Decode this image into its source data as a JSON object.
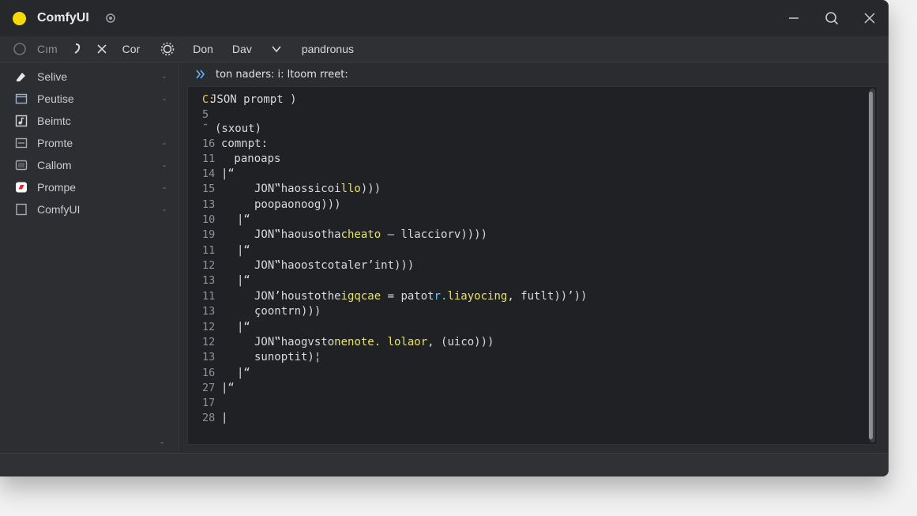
{
  "window": {
    "title": "ComfyUI"
  },
  "toolbar": {
    "items": [
      {
        "label": "Cım",
        "icon": "circle-icon"
      },
      {
        "label": "",
        "icon": "link-icon"
      },
      {
        "label": "",
        "icon": "crossed-arrows-icon"
      },
      {
        "label": "Cor"
      },
      {
        "label": "",
        "icon": "settings-icon"
      },
      {
        "label": "Don"
      },
      {
        "label": "Dav"
      },
      {
        "label": "",
        "icon": "chevron-down-icon"
      },
      {
        "label": "pandronus"
      }
    ]
  },
  "sidebar": {
    "items": [
      {
        "label": "Selive",
        "icon": "pen-icon",
        "trail": "-"
      },
      {
        "label": "Peutise",
        "icon": "window-icon",
        "trail": "-"
      },
      {
        "label": "Beimtc",
        "icon": "music-note-icon",
        "trail": ""
      },
      {
        "label": "Promte",
        "icon": "file-icon",
        "trail": "-"
      },
      {
        "label": "Callom",
        "icon": "panel-icon",
        "trail": "-"
      },
      {
        "label": "Prompe",
        "icon": "red-badge-icon",
        "trail": "-"
      },
      {
        "label": "ComfyUI",
        "icon": "document-icon",
        "trail": "-"
      }
    ],
    "bottom_mark": "-"
  },
  "breadcrumb": {
    "icon": "chevrons-right-icon",
    "text": "ton naders: i: ltoom rreet:"
  },
  "editor": {
    "lines": [
      {
        "n": "C:",
        "segs": [
          {
            "t": "JSON prompt )",
            "c": ""
          }
        ],
        "nk": true
      },
      {
        "n": "5",
        "segs": []
      },
      {
        "n": "˜",
        "segs": [
          {
            "t": "(sxout)",
            "c": ""
          }
        ]
      },
      {
        "n": "16",
        "segs": [
          {
            "t": "comnpt:",
            "c": ""
          }
        ]
      },
      {
        "n": "11",
        "segs": [
          {
            "t": " panoaps",
            "c": ""
          }
        ]
      },
      {
        "n": "14",
        "segs": [
          {
            "t": "|“",
            "c": ""
          }
        ]
      },
      {
        "n": "15",
        "segs": [
          {
            "t": "JON‟haossicoi",
            "c": ""
          },
          {
            "t": "llo",
            "c": "fn"
          },
          {
            "t": ")))",
            "c": ""
          }
        ]
      },
      {
        "n": "13",
        "segs": [
          {
            "t": "poopaonoog)))",
            "c": ""
          }
        ]
      },
      {
        "n": "10",
        "segs": [
          {
            "t": "|“",
            "c": ""
          }
        ]
      },
      {
        "n": "19",
        "segs": [
          {
            "t": "JON‟haousotha",
            "c": ""
          },
          {
            "t": "cheato",
            "c": "fn"
          },
          {
            "t": " – l",
            "c": ""
          },
          {
            "t": "lacciorv",
            "c": ""
          },
          {
            "t": "))))",
            "c": ""
          }
        ]
      },
      {
        "n": "11",
        "segs": [
          {
            "t": "|“",
            "c": ""
          }
        ]
      },
      {
        "n": "12",
        "segs": [
          {
            "t": "JON‟haoostcotaler’int)))",
            "c": ""
          }
        ]
      },
      {
        "n": "13",
        "segs": [
          {
            "t": "|“",
            "c": ""
          }
        ]
      },
      {
        "n": "11",
        "segs": [
          {
            "t": "JON’houstothe",
            "c": ""
          },
          {
            "t": "igqcae",
            "c": "fn"
          },
          {
            "t": " = patot",
            "c": ""
          },
          {
            "t": "r.",
            "c": "str"
          },
          {
            "t": "liayocing",
            "c": "fn"
          },
          {
            "t": ", futlt))’))",
            "c": ""
          }
        ]
      },
      {
        "n": "13",
        "segs": [
          {
            "t": "çoontrn)))",
            "c": ""
          }
        ]
      },
      {
        "n": "12",
        "segs": [
          {
            "t": "|“",
            "c": ""
          }
        ]
      },
      {
        "n": "12",
        "segs": [
          {
            "t": "JON‟haogvsto",
            "c": ""
          },
          {
            "t": "nenote. lolaor",
            "c": "fn"
          },
          {
            "t": ", (uico)))",
            "c": ""
          }
        ]
      },
      {
        "n": "13",
        "segs": [
          {
            "t": "sunoptit)¦",
            "c": ""
          }
        ]
      },
      {
        "n": "16",
        "segs": [
          {
            "t": "|“",
            "c": ""
          }
        ]
      },
      {
        "n": "27",
        "segs": [
          {
            "t": "|“",
            "c": ""
          }
        ]
      },
      {
        "n": "17",
        "segs": []
      },
      {
        "n": "28",
        "segs": [
          {
            "t": "|",
            "c": ""
          }
        ]
      }
    ]
  },
  "colors": {
    "accent": "#f5d90a",
    "bg": "#2a2c2f",
    "editor_bg": "#1f2124"
  }
}
